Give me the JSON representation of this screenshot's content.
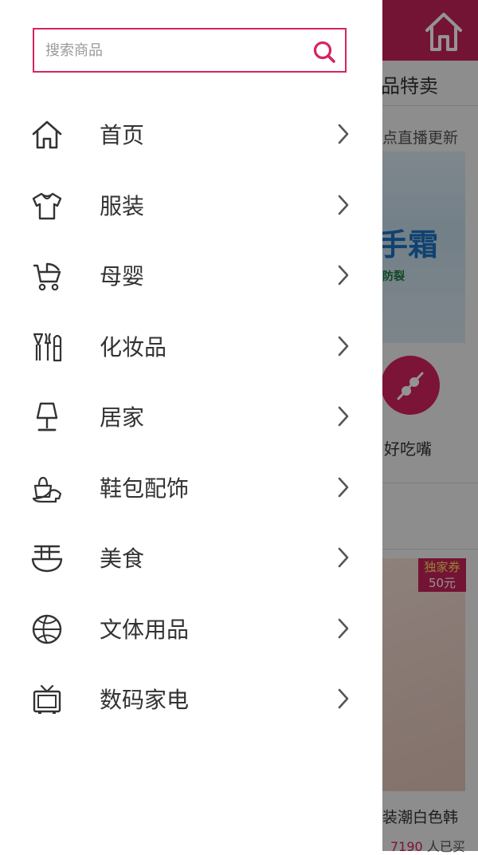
{
  "search": {
    "placeholder": "搜索商品",
    "value": ""
  },
  "menu": {
    "items": [
      {
        "id": "home",
        "label": "首页",
        "icon": "home-icon"
      },
      {
        "id": "clothing",
        "label": "服装",
        "icon": "tshirt-icon"
      },
      {
        "id": "mother-baby",
        "label": "母婴",
        "icon": "stroller-icon"
      },
      {
        "id": "cosmetics",
        "label": "化妆品",
        "icon": "makeup-brushes-icon"
      },
      {
        "id": "home-living",
        "label": "居家",
        "icon": "lamp-icon"
      },
      {
        "id": "shoes-bags",
        "label": "鞋包配饰",
        "icon": "bag-shoe-icon"
      },
      {
        "id": "food",
        "label": "美食",
        "icon": "noodle-bowl-icon"
      },
      {
        "id": "sports",
        "label": "文体用品",
        "icon": "ball-icon"
      },
      {
        "id": "electronics",
        "label": "数码家电",
        "icon": "tv-icon"
      }
    ]
  },
  "background": {
    "section_title": "品特卖",
    "subtitle": "点直播更新",
    "banner_big": "手霜",
    "banner_small": "防裂",
    "category_label": "好吃嘴",
    "badge_line1": "独家券",
    "badge_line2": "50元",
    "product_name": "装潮白色韩",
    "sold_count": "7190",
    "sold_unit": "人已买"
  },
  "colors": {
    "accent": "#d6245f",
    "topbar": "#c8245c",
    "icon": "#333333",
    "chevron": "#555555"
  }
}
